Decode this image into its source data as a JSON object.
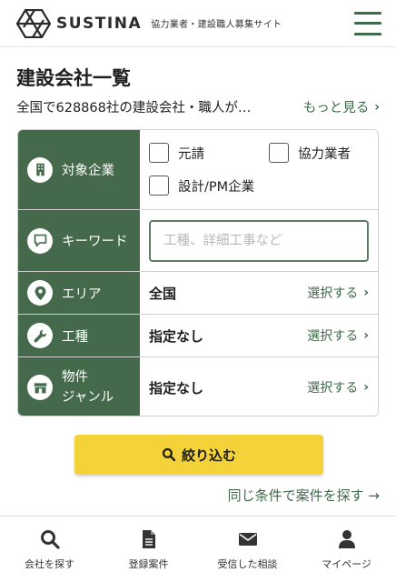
{
  "header": {
    "brand": "SUSTINA",
    "tagline": "協力業者・建設職人募集サイト"
  },
  "main": {
    "title": "建設会社一覧",
    "summary": "全国で628868社の建設会社・職人が…",
    "see_more": "もっと見る"
  },
  "filters": {
    "company_type": {
      "label": "対象企業",
      "options": [
        "元請",
        "協力業者",
        "設計/PM企業"
      ]
    },
    "keyword": {
      "label": "キーワード",
      "placeholder": "工種、詳細工事など"
    },
    "area": {
      "label": "エリア",
      "value": "全国",
      "action": "選択する"
    },
    "trade": {
      "label": "工種",
      "value": "指定なし",
      "action": "選択する"
    },
    "genre": {
      "label_line1": "物件",
      "label_line2": "ジャンル",
      "value": "指定なし",
      "action": "選択する"
    }
  },
  "search_button": "絞り込む",
  "same_conditions_link": "同じ条件で案件を探す →",
  "bottom_nav": [
    {
      "label": "会社を探す",
      "icon": "search-icon"
    },
    {
      "label": "登録案件",
      "icon": "document-icon"
    },
    {
      "label": "受信した相談",
      "icon": "envelope-icon"
    },
    {
      "label": "マイページ",
      "icon": "user-icon"
    }
  ],
  "colors": {
    "brand_green": "#456a4b",
    "link_green": "#3f6a4a",
    "button_yellow": "#f3d23a"
  }
}
